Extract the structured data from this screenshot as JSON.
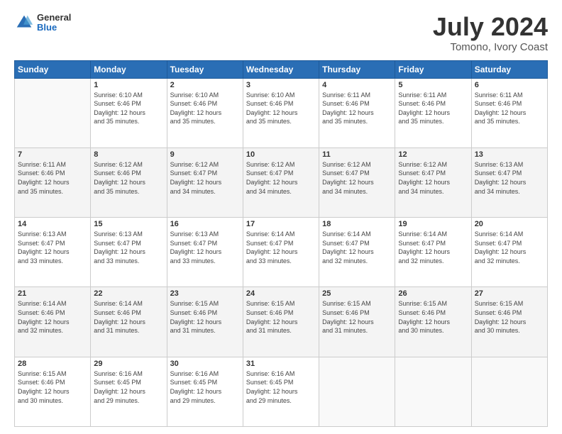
{
  "header": {
    "logo": {
      "general": "General",
      "blue": "Blue"
    },
    "title": "July 2024",
    "subtitle": "Tomono, Ivory Coast"
  },
  "days_of_week": [
    "Sunday",
    "Monday",
    "Tuesday",
    "Wednesday",
    "Thursday",
    "Friday",
    "Saturday"
  ],
  "weeks": [
    [
      {
        "day": "",
        "info": ""
      },
      {
        "day": "1",
        "info": "Sunrise: 6:10 AM\nSunset: 6:46 PM\nDaylight: 12 hours\nand 35 minutes."
      },
      {
        "day": "2",
        "info": "Sunrise: 6:10 AM\nSunset: 6:46 PM\nDaylight: 12 hours\nand 35 minutes."
      },
      {
        "day": "3",
        "info": "Sunrise: 6:10 AM\nSunset: 6:46 PM\nDaylight: 12 hours\nand 35 minutes."
      },
      {
        "day": "4",
        "info": "Sunrise: 6:11 AM\nSunset: 6:46 PM\nDaylight: 12 hours\nand 35 minutes."
      },
      {
        "day": "5",
        "info": "Sunrise: 6:11 AM\nSunset: 6:46 PM\nDaylight: 12 hours\nand 35 minutes."
      },
      {
        "day": "6",
        "info": "Sunrise: 6:11 AM\nSunset: 6:46 PM\nDaylight: 12 hours\nand 35 minutes."
      }
    ],
    [
      {
        "day": "7",
        "info": "Sunrise: 6:11 AM\nSunset: 6:46 PM\nDaylight: 12 hours\nand 35 minutes."
      },
      {
        "day": "8",
        "info": "Sunrise: 6:12 AM\nSunset: 6:46 PM\nDaylight: 12 hours\nand 35 minutes."
      },
      {
        "day": "9",
        "info": "Sunrise: 6:12 AM\nSunset: 6:47 PM\nDaylight: 12 hours\nand 34 minutes."
      },
      {
        "day": "10",
        "info": "Sunrise: 6:12 AM\nSunset: 6:47 PM\nDaylight: 12 hours\nand 34 minutes."
      },
      {
        "day": "11",
        "info": "Sunrise: 6:12 AM\nSunset: 6:47 PM\nDaylight: 12 hours\nand 34 minutes."
      },
      {
        "day": "12",
        "info": "Sunrise: 6:12 AM\nSunset: 6:47 PM\nDaylight: 12 hours\nand 34 minutes."
      },
      {
        "day": "13",
        "info": "Sunrise: 6:13 AM\nSunset: 6:47 PM\nDaylight: 12 hours\nand 34 minutes."
      }
    ],
    [
      {
        "day": "14",
        "info": "Sunrise: 6:13 AM\nSunset: 6:47 PM\nDaylight: 12 hours\nand 33 minutes."
      },
      {
        "day": "15",
        "info": "Sunrise: 6:13 AM\nSunset: 6:47 PM\nDaylight: 12 hours\nand 33 minutes."
      },
      {
        "day": "16",
        "info": "Sunrise: 6:13 AM\nSunset: 6:47 PM\nDaylight: 12 hours\nand 33 minutes."
      },
      {
        "day": "17",
        "info": "Sunrise: 6:14 AM\nSunset: 6:47 PM\nDaylight: 12 hours\nand 33 minutes."
      },
      {
        "day": "18",
        "info": "Sunrise: 6:14 AM\nSunset: 6:47 PM\nDaylight: 12 hours\nand 32 minutes."
      },
      {
        "day": "19",
        "info": "Sunrise: 6:14 AM\nSunset: 6:47 PM\nDaylight: 12 hours\nand 32 minutes."
      },
      {
        "day": "20",
        "info": "Sunrise: 6:14 AM\nSunset: 6:47 PM\nDaylight: 12 hours\nand 32 minutes."
      }
    ],
    [
      {
        "day": "21",
        "info": "Sunrise: 6:14 AM\nSunset: 6:46 PM\nDaylight: 12 hours\nand 32 minutes."
      },
      {
        "day": "22",
        "info": "Sunrise: 6:14 AM\nSunset: 6:46 PM\nDaylight: 12 hours\nand 31 minutes."
      },
      {
        "day": "23",
        "info": "Sunrise: 6:15 AM\nSunset: 6:46 PM\nDaylight: 12 hours\nand 31 minutes."
      },
      {
        "day": "24",
        "info": "Sunrise: 6:15 AM\nSunset: 6:46 PM\nDaylight: 12 hours\nand 31 minutes."
      },
      {
        "day": "25",
        "info": "Sunrise: 6:15 AM\nSunset: 6:46 PM\nDaylight: 12 hours\nand 31 minutes."
      },
      {
        "day": "26",
        "info": "Sunrise: 6:15 AM\nSunset: 6:46 PM\nDaylight: 12 hours\nand 30 minutes."
      },
      {
        "day": "27",
        "info": "Sunrise: 6:15 AM\nSunset: 6:46 PM\nDaylight: 12 hours\nand 30 minutes."
      }
    ],
    [
      {
        "day": "28",
        "info": "Sunrise: 6:15 AM\nSunset: 6:46 PM\nDaylight: 12 hours\nand 30 minutes."
      },
      {
        "day": "29",
        "info": "Sunrise: 6:16 AM\nSunset: 6:45 PM\nDaylight: 12 hours\nand 29 minutes."
      },
      {
        "day": "30",
        "info": "Sunrise: 6:16 AM\nSunset: 6:45 PM\nDaylight: 12 hours\nand 29 minutes."
      },
      {
        "day": "31",
        "info": "Sunrise: 6:16 AM\nSunset: 6:45 PM\nDaylight: 12 hours\nand 29 minutes."
      },
      {
        "day": "",
        "info": ""
      },
      {
        "day": "",
        "info": ""
      },
      {
        "day": "",
        "info": ""
      }
    ]
  ]
}
